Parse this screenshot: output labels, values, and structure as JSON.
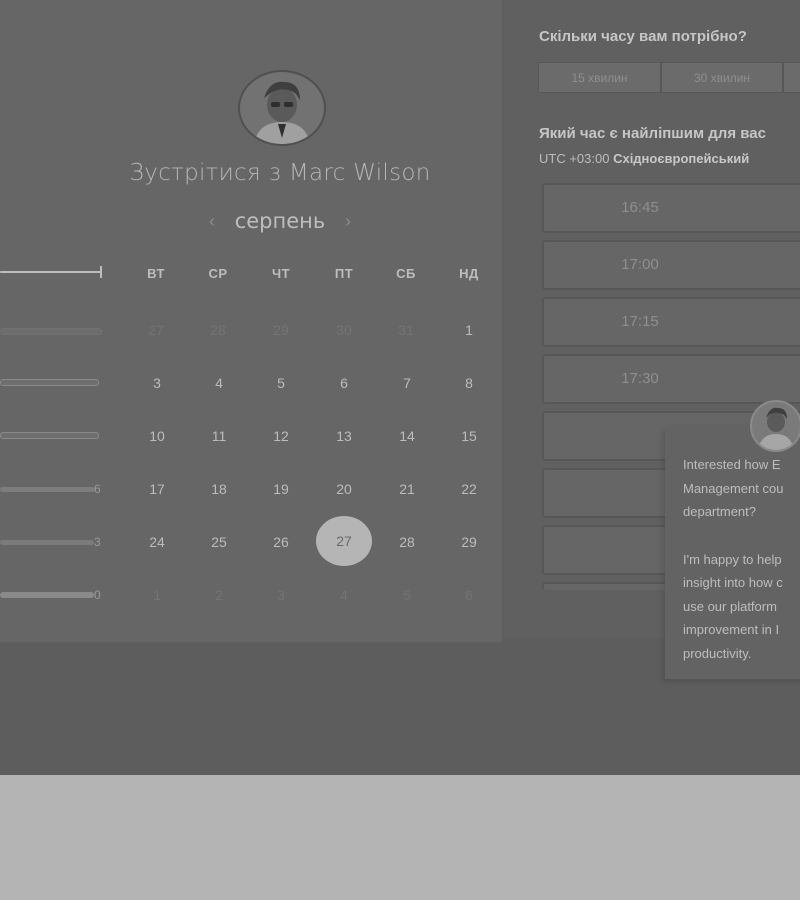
{
  "scheduler": {
    "title": "Зустрітися з Marc Wilson",
    "month": "серпень",
    "prev_icon": "chevron-left-icon",
    "next_icon": "chevron-right-icon",
    "weekdays": [
      "ВТ",
      "СР",
      "ЧТ",
      "ПТ",
      "СБ",
      "НД"
    ],
    "weeks": [
      [
        "27",
        "28",
        "29",
        "30",
        "31",
        "1"
      ],
      [
        "3",
        "4",
        "5",
        "6",
        "7",
        "8"
      ],
      [
        "10",
        "11",
        "12",
        "13",
        "14",
        "15"
      ],
      [
        "17",
        "18",
        "19",
        "20",
        "21",
        "22"
      ],
      [
        "24",
        "25",
        "26",
        "27",
        "28",
        "29"
      ],
      [
        "1",
        "2",
        "3",
        "4",
        "5",
        "6"
      ]
    ],
    "selected_day": "27",
    "side_counts": [
      "6",
      "3",
      "0"
    ]
  },
  "duration": {
    "question": "Скільки часу вам потрібно?",
    "options": [
      "15 хвилин",
      "30 хвилин"
    ]
  },
  "time": {
    "question": "Який час є найліпшим для вас",
    "tz_prefix": "UTC +03:00",
    "tz_name": "Східноєвропейський",
    "slots": [
      "16:45",
      "17:00",
      "17:15",
      "17:30"
    ]
  },
  "chat": {
    "lines1": [
      "Interested how E",
      "Management cou",
      "department?"
    ],
    "lines2": [
      "I'm happy to help",
      "insight into how c",
      "use our platform",
      "improvement in I",
      "productivity."
    ]
  }
}
